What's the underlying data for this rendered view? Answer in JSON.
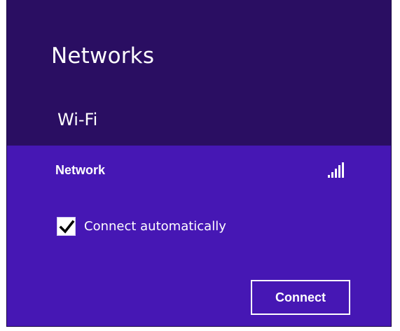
{
  "panel": {
    "title": "Networks",
    "section_label": "Wi-Fi",
    "colors": {
      "panel_bg": "#2a0e62",
      "selected_item_bg": "#4617b4",
      "text": "#ffffff"
    }
  },
  "network": {
    "name": "Network",
    "signal_icon": "signal-strength-icon",
    "signal_bars": 5,
    "connect_automatically": {
      "label": "Connect automatically",
      "checked": true
    },
    "connect_button_label": "Connect"
  }
}
